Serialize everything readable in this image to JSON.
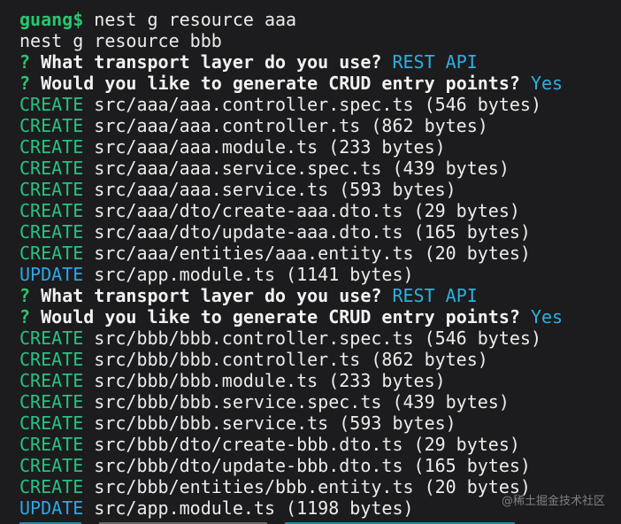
{
  "terminal": {
    "lines": [
      {
        "kind": "prompt",
        "user": "guang$",
        "command": " nest g resource aaa"
      },
      {
        "kind": "plain",
        "text": "nest g resource bbb"
      },
      {
        "kind": "question",
        "mark": "?",
        "question": " What transport layer do you use?",
        "answer": " REST API"
      },
      {
        "kind": "question",
        "mark": "?",
        "question": " Would you like to generate CRUD entry points?",
        "answer": " Yes"
      },
      {
        "kind": "file",
        "action": "CREATE",
        "path": " src/aaa/aaa.controller.spec.ts (546 bytes)"
      },
      {
        "kind": "file",
        "action": "CREATE",
        "path": " src/aaa/aaa.controller.ts (862 bytes)"
      },
      {
        "kind": "file",
        "action": "CREATE",
        "path": " src/aaa/aaa.module.ts (233 bytes)"
      },
      {
        "kind": "file",
        "action": "CREATE",
        "path": " src/aaa/aaa.service.spec.ts (439 bytes)"
      },
      {
        "kind": "file",
        "action": "CREATE",
        "path": " src/aaa/aaa.service.ts (593 bytes)"
      },
      {
        "kind": "file",
        "action": "CREATE",
        "path": " src/aaa/dto/create-aaa.dto.ts (29 bytes)"
      },
      {
        "kind": "file",
        "action": "CREATE",
        "path": " src/aaa/dto/update-aaa.dto.ts (165 bytes)"
      },
      {
        "kind": "file",
        "action": "CREATE",
        "path": " src/aaa/entities/aaa.entity.ts (20 bytes)"
      },
      {
        "kind": "file",
        "action": "UPDATE",
        "path": " src/app.module.ts (1141 bytes)"
      },
      {
        "kind": "question",
        "mark": "?",
        "question": " What transport layer do you use?",
        "answer": " REST API"
      },
      {
        "kind": "question",
        "mark": "?",
        "question": " Would you like to generate CRUD entry points?",
        "answer": " Yes"
      },
      {
        "kind": "file",
        "action": "CREATE",
        "path": " src/bbb/bbb.controller.spec.ts (546 bytes)"
      },
      {
        "kind": "file",
        "action": "CREATE",
        "path": " src/bbb/bbb.controller.ts (862 bytes)"
      },
      {
        "kind": "file",
        "action": "CREATE",
        "path": " src/bbb/bbb.module.ts (233 bytes)"
      },
      {
        "kind": "file",
        "action": "CREATE",
        "path": " src/bbb/bbb.service.spec.ts (439 bytes)"
      },
      {
        "kind": "file",
        "action": "CREATE",
        "path": " src/bbb/bbb.service.ts (593 bytes)"
      },
      {
        "kind": "file",
        "action": "CREATE",
        "path": " src/bbb/dto/create-bbb.dto.ts (29 bytes)"
      },
      {
        "kind": "file",
        "action": "CREATE",
        "path": " src/bbb/dto/update-bbb.dto.ts (165 bytes)"
      },
      {
        "kind": "file",
        "action": "CREATE",
        "path": " src/bbb/entities/bbb.entity.ts (20 bytes)"
      },
      {
        "kind": "file",
        "action": "UPDATE",
        "path": " src/app.module.ts (1198 bytes)"
      }
    ]
  },
  "watermark": "@稀土掘金技术社区",
  "colors": {
    "background": "#1c1c1e",
    "prompt": "#28c76f",
    "create": "#26c281",
    "update": "#2aa8e8",
    "answer": "#2bb0e0",
    "text": "#ececec"
  }
}
